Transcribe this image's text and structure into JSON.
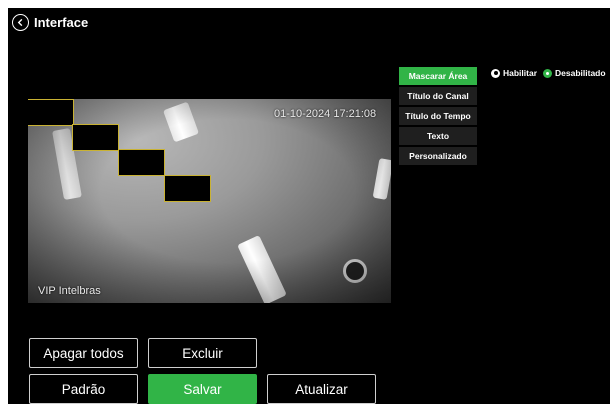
{
  "header": {
    "title": "Interface"
  },
  "video": {
    "timestamp": "01-10-2024 17:21:08",
    "channel_name": "VIP Intelbras"
  },
  "tabs": [
    {
      "label": "Mascarar Área",
      "active": true
    },
    {
      "label": "Título do Canal",
      "active": false
    },
    {
      "label": "Título do Tempo",
      "active": false
    },
    {
      "label": "Texto",
      "active": false
    },
    {
      "label": "Personalizado",
      "active": false
    }
  ],
  "options": {
    "enable_label": "Habilitar",
    "disable_label": "Desabilitado",
    "selected": "Desabilitado"
  },
  "buttons": {
    "clear_all": "Apagar todos",
    "delete": "Excluir",
    "default": "Padrão",
    "save": "Salvar",
    "refresh": "Atualizar"
  },
  "colors": {
    "accent": "#31b447",
    "background": "#000000"
  }
}
